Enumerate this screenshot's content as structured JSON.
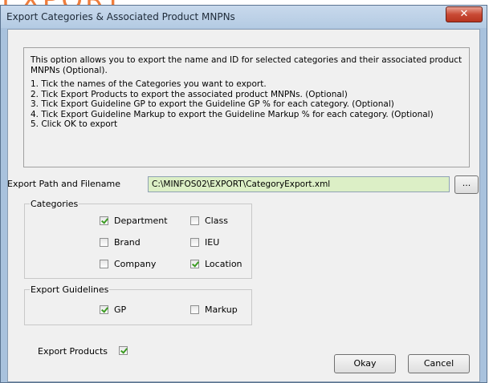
{
  "background": {
    "heading": "EXPORT",
    "heading_color": "#ef7d3c"
  },
  "window": {
    "title": "Export Categories & Associated Product MNPNs",
    "close_icon": "close-icon"
  },
  "info": {
    "intro": "This option allows you to export the name and ID for selected categories and their associated product MNPNs (Optional).",
    "steps": [
      "1. Tick the names of the Categories you want to export.",
      "2. Tick Export Products to export the associated product MNPNs. (Optional)",
      "3. Tick Export Guideline GP to export the Guideline GP % for each category. (Optional)",
      "4. Tick Export Guideline Markup to export the Guideline Markup % for each category. (Optional)",
      "5. Click OK to export"
    ]
  },
  "export_path": {
    "label": "Export Path and Filename",
    "value": "C:\\MINFOS02\\EXPORT\\CategoryExport.xml",
    "browse_label": "...",
    "field_color": "#dcefc6"
  },
  "categories": {
    "legend": "Categories",
    "items": [
      {
        "label": "Department",
        "checked": true
      },
      {
        "label": "Class",
        "checked": false
      },
      {
        "label": "Brand",
        "checked": false
      },
      {
        "label": "IEU",
        "checked": false
      },
      {
        "label": "Company",
        "checked": false
      },
      {
        "label": "Location",
        "checked": true
      }
    ]
  },
  "guidelines": {
    "legend": "Export Guidelines",
    "items": [
      {
        "label": "GP",
        "checked": true
      },
      {
        "label": "Markup",
        "checked": false
      }
    ]
  },
  "export_products": {
    "label": "Export Products",
    "checked": true
  },
  "buttons": {
    "okay": "Okay",
    "cancel": "Cancel"
  },
  "colors": {
    "check_mark": "#3b9b22",
    "close_button": "#c94a35"
  }
}
